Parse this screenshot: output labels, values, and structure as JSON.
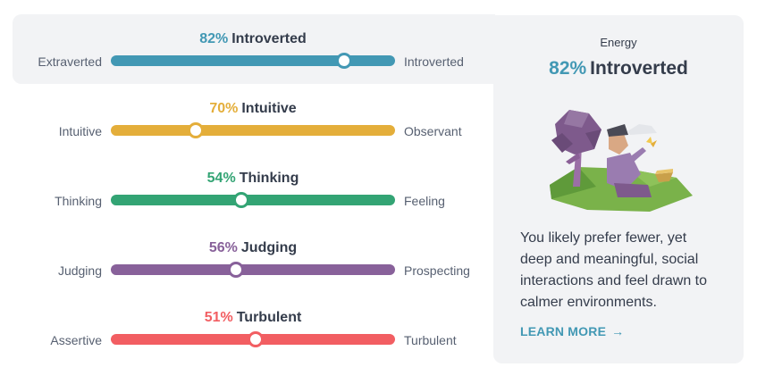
{
  "traits": [
    {
      "percent": "82%",
      "trait": "Introverted",
      "left": "Extraverted",
      "right": "Introverted",
      "color": "#4298b4",
      "value": 0.82,
      "active": true
    },
    {
      "percent": "70%",
      "trait": "Intuitive",
      "left": "Intuitive",
      "right": "Observant",
      "color": "#e4ae3a",
      "value": 0.3,
      "active": false
    },
    {
      "percent": "54%",
      "trait": "Thinking",
      "left": "Thinking",
      "right": "Feeling",
      "color": "#33a474",
      "value": 0.46,
      "active": false
    },
    {
      "percent": "56%",
      "trait": "Judging",
      "left": "Judging",
      "right": "Prospecting",
      "color": "#88619a",
      "value": 0.44,
      "active": false
    },
    {
      "percent": "51%",
      "trait": "Turbulent",
      "left": "Assertive",
      "right": "Turbulent",
      "color": "#f25e62",
      "value": 0.51,
      "active": false
    }
  ],
  "panel": {
    "category": "Energy",
    "percent": "82%",
    "trait": "Introverted",
    "description": "You likely prefer fewer, yet deep and meaningful, social interactions and feel drawn to calmer environments.",
    "learn_more": "LEARN MORE",
    "learn_more_icon": "arrow-right-icon",
    "illustration": "introvert-under-tree-illustration"
  }
}
